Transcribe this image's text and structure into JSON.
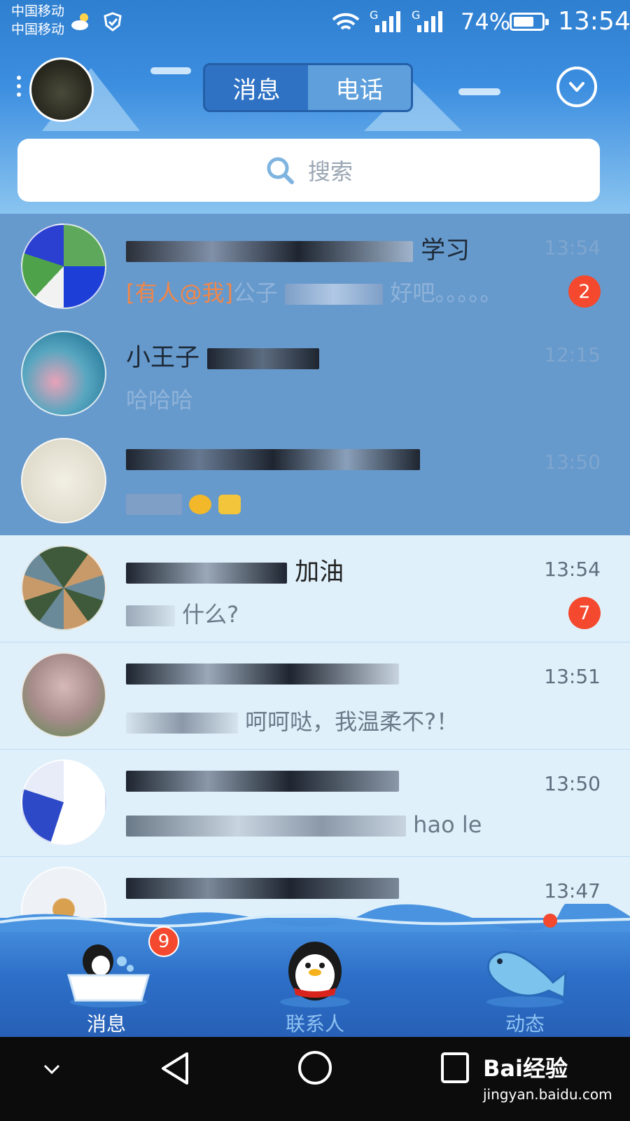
{
  "status_bar": {
    "carrier_1": "中国移动",
    "carrier_2": "中国移动",
    "network_1": "G",
    "network_2": "G",
    "battery_percent": "74%",
    "battery_level": 0.74,
    "time": "13:54"
  },
  "header": {
    "tabs": [
      {
        "label": "消息",
        "active": true
      },
      {
        "label": "电话",
        "active": false
      }
    ],
    "search_placeholder": "搜索"
  },
  "conversations": [
    {
      "name_visible": "学习",
      "time": "13:54",
      "mention": "[有人@我]",
      "msg_visible": "公子",
      "msg_tail": "好吧。。。。。",
      "badge": "2",
      "pinned": true
    },
    {
      "name_visible": "小王子",
      "time": "12:15",
      "msg_visible": "哈哈哈",
      "pinned": true
    },
    {
      "name_visible": "",
      "time": "13:50",
      "msg_visible": "",
      "pinned": true
    },
    {
      "name_visible": "加油",
      "time": "13:54",
      "msg_visible": "什么?",
      "badge": "7",
      "pinned": false
    },
    {
      "name_visible": "",
      "time": "13:51",
      "msg_visible": "呵呵哒，我温柔不?！",
      "pinned": false
    },
    {
      "name_visible": "",
      "time": "13:50",
      "msg_visible": "hao le",
      "pinned": false
    },
    {
      "name_visible": "",
      "time": "13:47",
      "msg_visible": "",
      "pinned": false
    }
  ],
  "tabbar": {
    "items": [
      {
        "label": "消息",
        "badge": "9",
        "active": true
      },
      {
        "label": "联系人",
        "active": false
      },
      {
        "label": "动态",
        "active": false
      }
    ]
  },
  "watermark": {
    "text": "Bai经验",
    "sub": "jingyan.baidu.com"
  }
}
